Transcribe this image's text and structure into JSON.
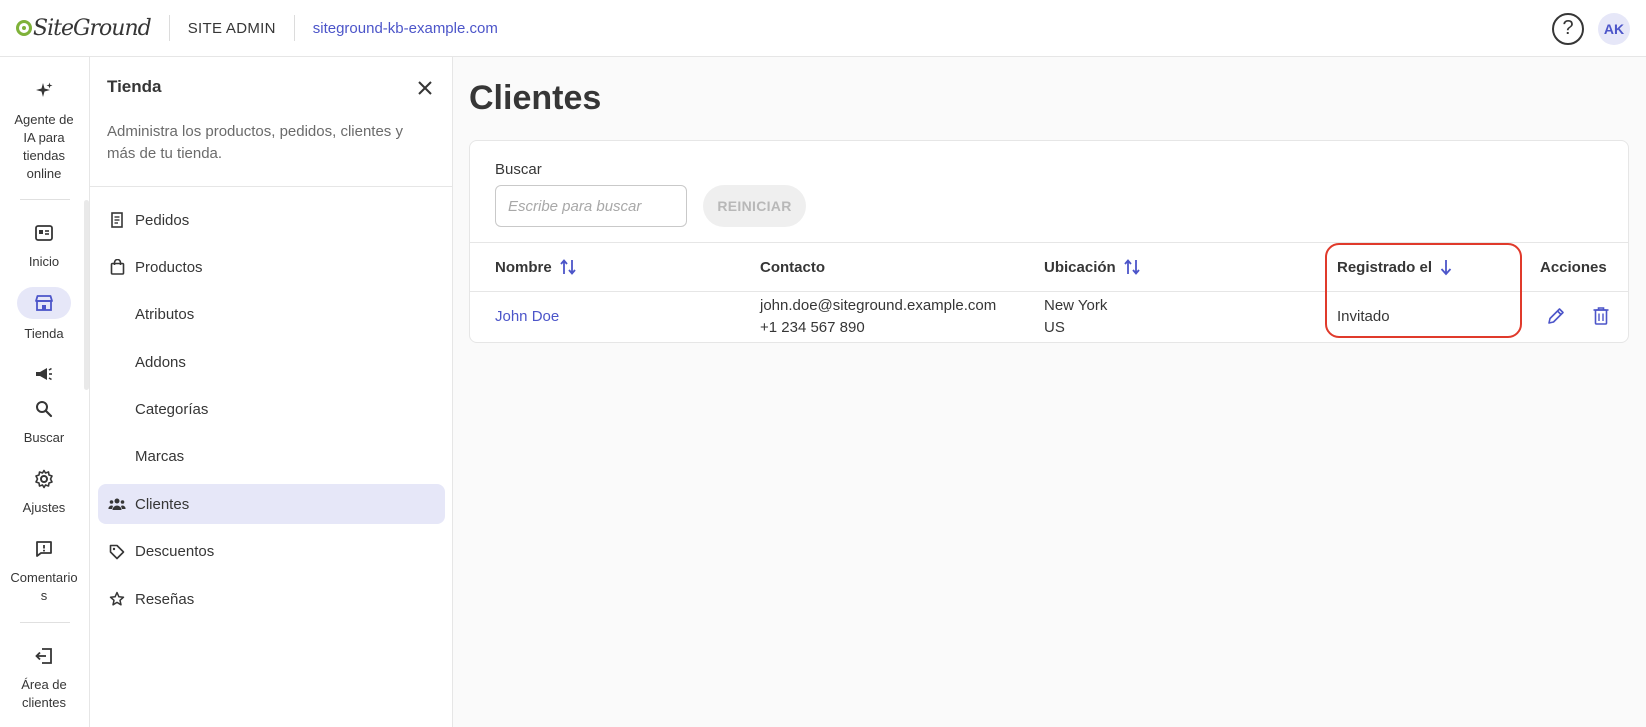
{
  "header": {
    "brand": "SiteGround",
    "section": "SITE ADMIN",
    "site_url": "siteground-kb-example.com",
    "help_label": "?",
    "avatar_initials": "AK"
  },
  "rail": {
    "items": [
      {
        "label": "Agente de IA para tiendas online",
        "icon": "sparkles-icon"
      },
      {
        "label": "Inicio",
        "icon": "dashboard-icon"
      },
      {
        "label": "Tienda",
        "icon": "store-icon",
        "active": true
      },
      {
        "label": "",
        "icon": "megaphone-icon"
      },
      {
        "label": "Buscar",
        "icon": "search-icon"
      },
      {
        "label": "Ajustes",
        "icon": "gear-icon"
      },
      {
        "label": "Comentarios",
        "icon": "comment-alert-icon"
      },
      {
        "label": "Área de clientes",
        "icon": "exit-icon"
      }
    ]
  },
  "panel": {
    "title": "Tienda",
    "description": "Administra los productos, pedidos, clientes y más de tu tienda.",
    "nav": [
      {
        "label": "Pedidos",
        "icon": "receipt-icon"
      },
      {
        "label": "Productos",
        "icon": "shopping-bag-icon"
      },
      {
        "label": "Atributos",
        "sub": true
      },
      {
        "label": "Addons",
        "sub": true
      },
      {
        "label": "Categorías",
        "sub": true
      },
      {
        "label": "Marcas",
        "sub": true
      },
      {
        "label": "Clientes",
        "icon": "users-icon",
        "active": true
      },
      {
        "label": "Descuentos",
        "icon": "tag-icon"
      },
      {
        "label": "Reseñas",
        "icon": "star-icon"
      }
    ]
  },
  "main": {
    "title": "Clientes",
    "search": {
      "label": "Buscar",
      "placeholder": "Escribe para buscar",
      "value": ""
    },
    "reset_label": "REINICIAR",
    "table": {
      "columns": {
        "name": "Nombre",
        "contact": "Contacto",
        "location": "Ubicación",
        "registered": "Registrado el",
        "actions": "Acciones"
      },
      "rows": [
        {
          "name": "John Doe",
          "email": "john.doe@siteground.example.com",
          "phone": "+1 234 567 890",
          "city": "New York",
          "country": "US",
          "registered": "Invitado"
        }
      ]
    }
  },
  "colors": {
    "accent": "#4c55c9",
    "accent_bg": "#e6e7f8",
    "highlight": "#e03a2b",
    "brand_green": "#7fb23a"
  }
}
